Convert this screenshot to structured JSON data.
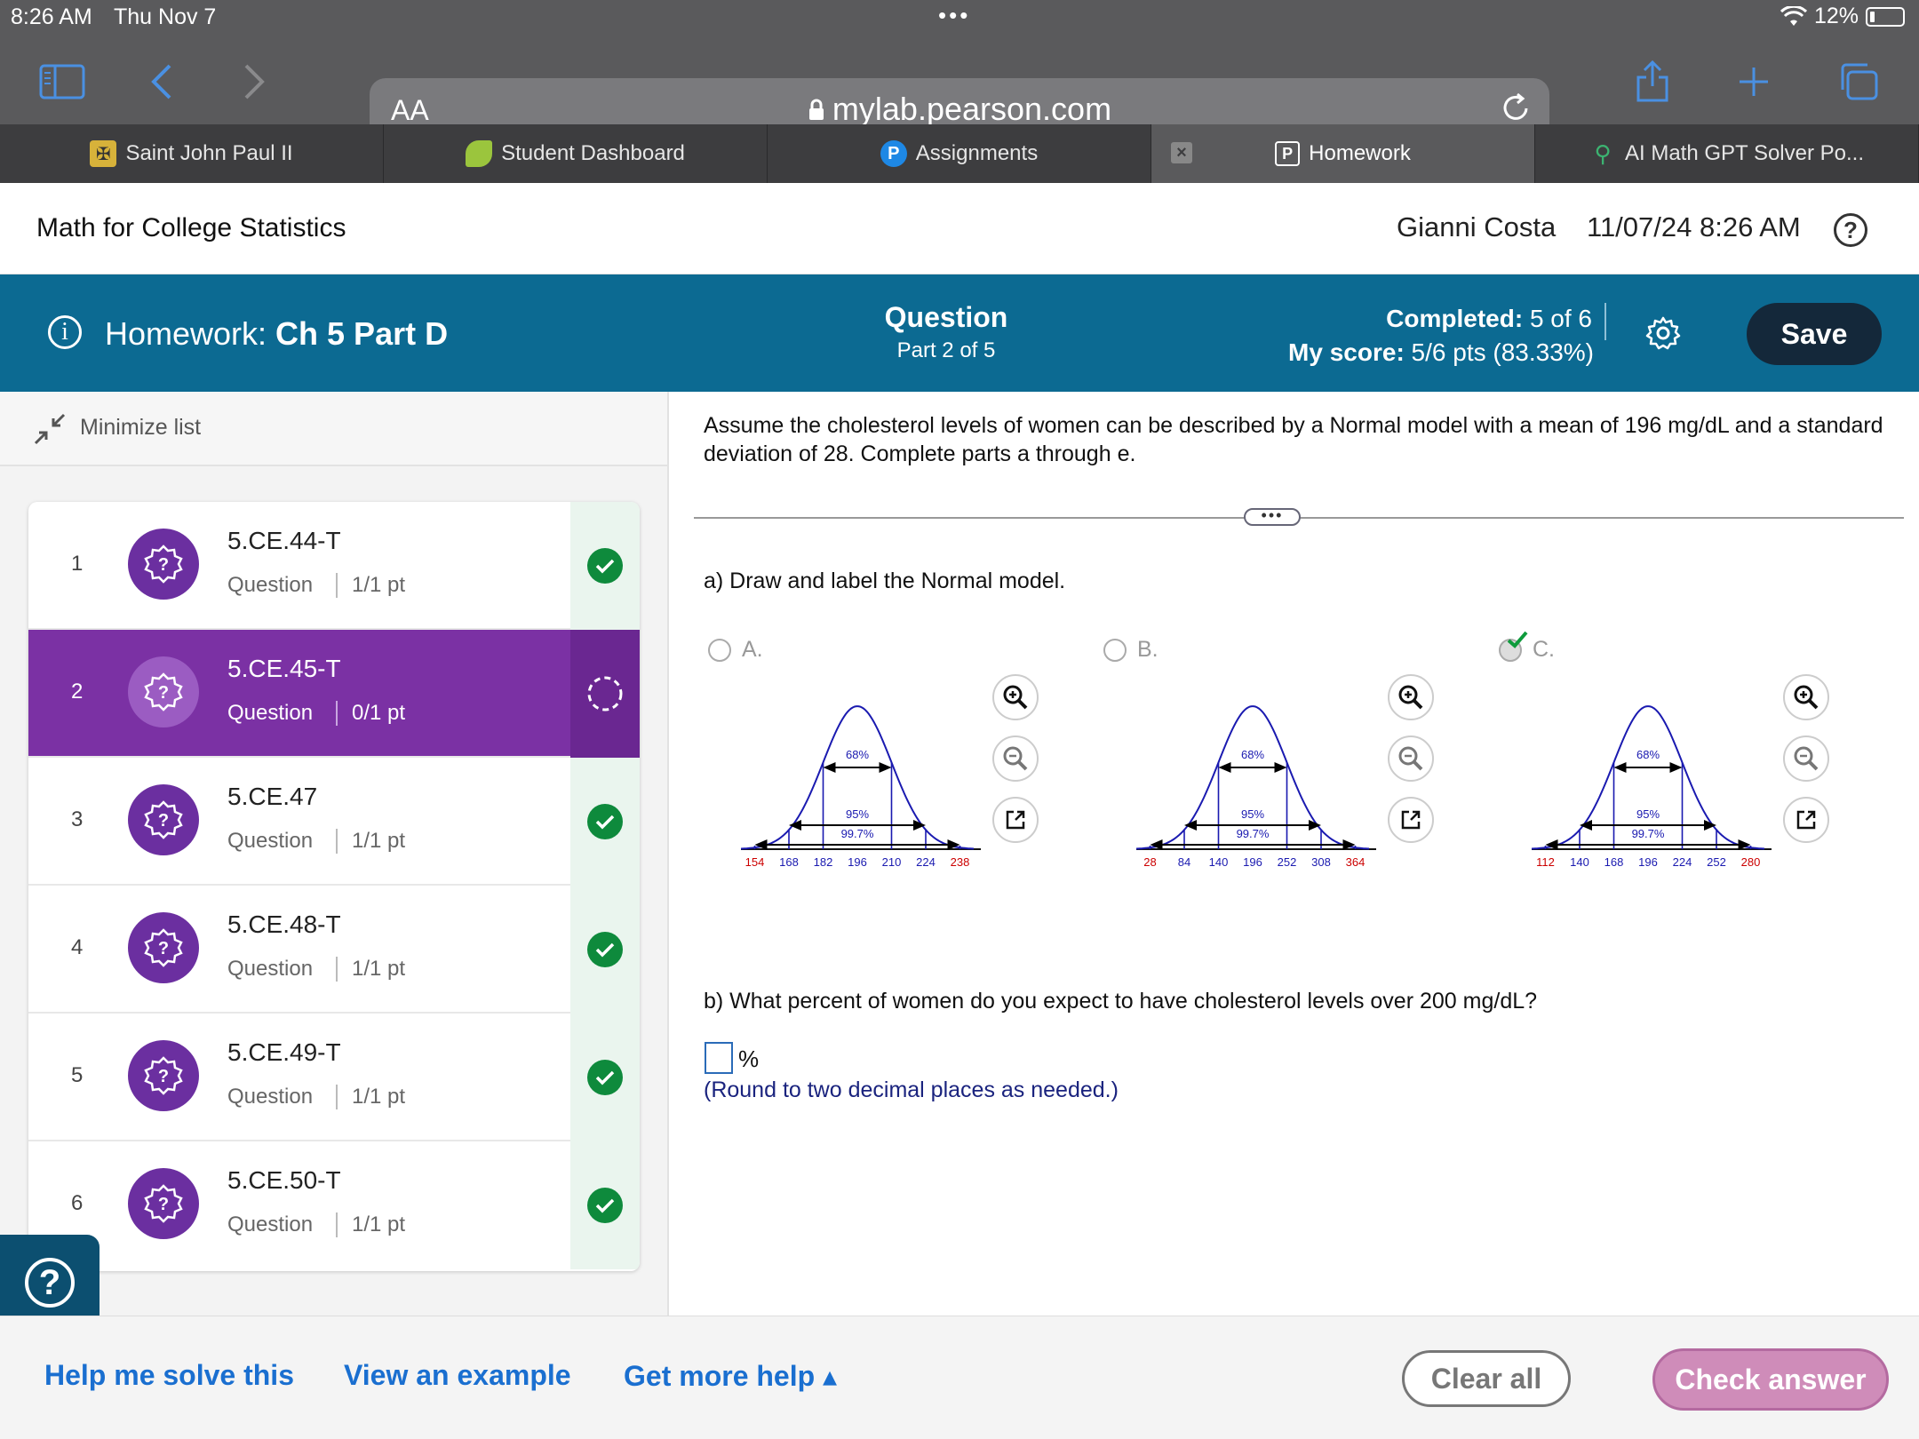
{
  "status_bar": {
    "time": "8:26 AM",
    "date": "Thu Nov 7",
    "battery": "12%"
  },
  "browser": {
    "text_size_label": "AA",
    "url": "mylab.pearson.com"
  },
  "tabs": [
    {
      "label": "Saint John Paul II"
    },
    {
      "label": "Student Dashboard"
    },
    {
      "label": "Assignments"
    },
    {
      "label": "Homework",
      "active": true
    },
    {
      "label": "AI Math GPT Solver Po..."
    }
  ],
  "course": {
    "title": "Math for College Statistics",
    "user": "Gianni Costa",
    "datetime": "11/07/24 8:26 AM"
  },
  "banner": {
    "homework_prefix": "Homework:",
    "homework_name": "Ch 5 Part D",
    "question_label": "Question",
    "question_part": "Part 2 of 5",
    "completed_label": "Completed:",
    "completed_value": "5 of 6",
    "score_label": "My score:",
    "score_value": "5/6 pts (83.33%)",
    "save_label": "Save"
  },
  "sidebar": {
    "minimize_label": "Minimize list",
    "items": [
      {
        "num": "1",
        "name": "5.CE.44-T",
        "type": "Question",
        "pts": "1/1 pt",
        "status": "correct"
      },
      {
        "num": "2",
        "name": "5.CE.45-T",
        "type": "Question",
        "pts": "0/1 pt",
        "status": "in-progress"
      },
      {
        "num": "3",
        "name": "5.CE.47",
        "type": "Question",
        "pts": "1/1 pt",
        "status": "correct"
      },
      {
        "num": "4",
        "name": "5.CE.48-T",
        "type": "Question",
        "pts": "1/1 pt",
        "status": "correct"
      },
      {
        "num": "5",
        "name": "5.CE.49-T",
        "type": "Question",
        "pts": "1/1 pt",
        "status": "correct"
      },
      {
        "num": "6",
        "name": "5.CE.50-T",
        "type": "Question",
        "pts": "1/1 pt",
        "status": "correct"
      }
    ]
  },
  "question": {
    "prompt": "Assume the cholesterol levels of women can be described by a Normal model with a mean of 196 mg/dL and a standard deviation of 28. Complete parts a through e.",
    "part_a": "a) Draw and label the Normal model.",
    "options": [
      {
        "label": "A.",
        "selected": false,
        "ticks": [
          "154",
          "168",
          "182",
          "196",
          "210",
          "224",
          "238"
        ]
      },
      {
        "label": "B.",
        "selected": false,
        "ticks": [
          "28",
          "84",
          "140",
          "196",
          "252",
          "308",
          "364"
        ]
      },
      {
        "label": "C.",
        "selected": true,
        "ticks": [
          "112",
          "140",
          "168",
          "196",
          "224",
          "252",
          "280"
        ]
      }
    ],
    "band_labels": {
      "inner": "68%",
      "middle": "95%",
      "outer": "99.7%"
    },
    "part_b": "b) What percent of women do you expect to have cholesterol levels over 200 mg/dL?",
    "answer_value": "",
    "unit": "%",
    "hint": "(Round to two decimal places as needed.)"
  },
  "footer": {
    "help_solve": "Help me solve this",
    "view_example": "View an example",
    "more_help": "Get more help ▴",
    "clear_all": "Clear all",
    "check_answer": "Check answer"
  },
  "colors": {
    "banner": "#0c6a92",
    "active_item": "#7b31a4",
    "badge": "#6b2fa0",
    "check": "#0e8a3c",
    "link": "#1a6fd0"
  }
}
